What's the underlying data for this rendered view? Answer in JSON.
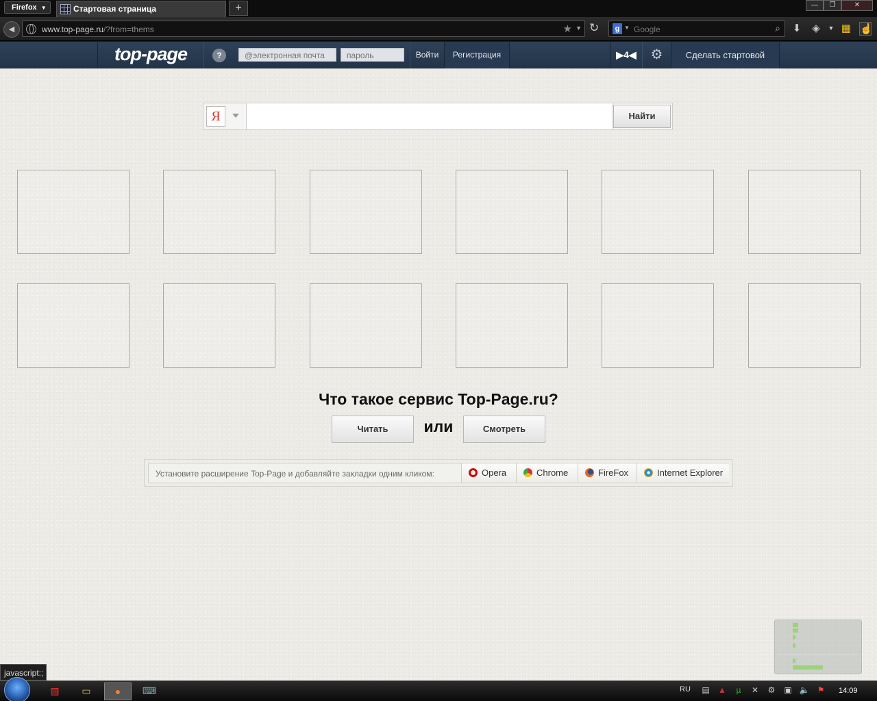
{
  "browser": {
    "menu_label": "Firefox",
    "tab_title": "Стартовая страница",
    "new_tab_label": "+",
    "url_domain": "www.top-page.ru",
    "url_rest": "/?from=thems",
    "search_placeholder": "Google",
    "window_controls": [
      "—",
      "❐",
      "✕"
    ]
  },
  "site": {
    "logo": "top-page",
    "help": "?",
    "email_placeholder": "@электронная почта",
    "password_placeholder": "пароль",
    "login": "Войти",
    "register": "Регистрация",
    "player": "▶4◀",
    "make_start": "Сделать стартовой"
  },
  "search": {
    "engine_icon": "Я",
    "button": "Найти"
  },
  "about": {
    "heading": "Что такое сервис Top-Page.ru?",
    "read": "Читать",
    "or": "или",
    "watch": "Смотреть"
  },
  "extensions": {
    "prompt": "Установите расширение Top-Page и добавляйте закладки одним кликом:",
    "browsers": [
      {
        "label": "Opera",
        "color": "#d40000"
      },
      {
        "label": "Chrome",
        "color": "#3aa84a"
      },
      {
        "label": "FireFox",
        "color": "#e66a18"
      },
      {
        "label": "Internet Explorer",
        "color": "#2a8fd6"
      }
    ]
  },
  "status_link": "javascript:;",
  "taskbar": {
    "lang": "RU",
    "clock": "14:09"
  }
}
